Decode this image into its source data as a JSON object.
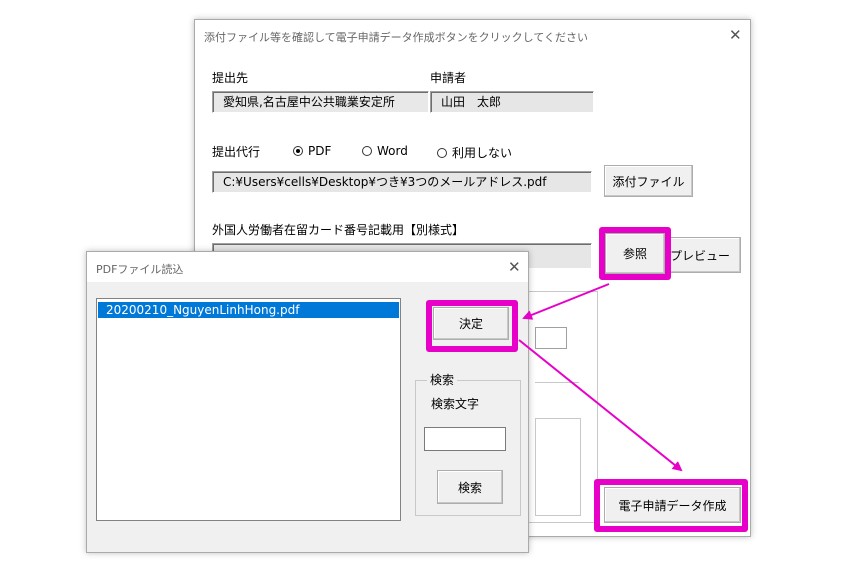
{
  "main_dialog": {
    "title": "添付ファイル等を確認して電子申請データ作成ボタンをクリックしてください",
    "submit_to_label": "提出先",
    "submit_to_value": "愛知県,名古屋中公共職業安定所",
    "applicant_label": "申請者",
    "applicant_value": "山田　太郎",
    "proxy_label": "提出代行",
    "radio_options": [
      {
        "label": "PDF",
        "selected": true
      },
      {
        "label": "Word",
        "selected": false
      },
      {
        "label": "利用しない",
        "selected": false
      }
    ],
    "proxy_file_path": "C:¥Users¥cells¥Desktop¥つき¥3つのメールアドレス.pdf",
    "attach_button": "添付ファイル",
    "foreign_label": "外国人労働者在留カード番号記載用【別様式】",
    "browse_button": "参照",
    "preview_button": "プレビュー",
    "create_button": "電子申請データ作成"
  },
  "pdf_dialog": {
    "title": "PDFファイル読込",
    "files": [
      "20200210_NguyenLinhHong.pdf"
    ],
    "ok_button": "決定",
    "search_group": "検索",
    "search_text_label": "検索文字",
    "search_value": "",
    "search_button": "検索"
  },
  "colors": {
    "highlight": "#e600c8",
    "selection": "#0078d7"
  }
}
